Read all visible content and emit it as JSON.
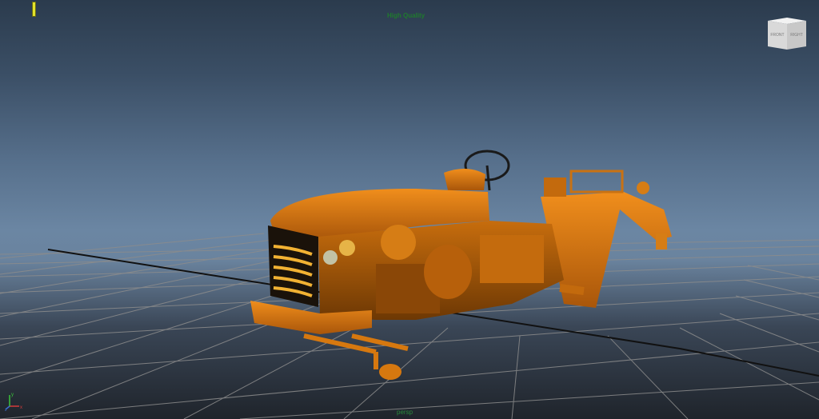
{
  "viewport": {
    "hud": {
      "quality_label": "High Quality",
      "camera_label": "persp"
    },
    "viewcube": {
      "left_face": "FRONT",
      "right_face": "RIGHT"
    },
    "axis_indicator": {
      "x_label": "x",
      "y_label": "y",
      "z_label": "z"
    },
    "colors": {
      "model": "#d6780f",
      "grid": "#8c8c8c",
      "hud_text": "#1f7a2d"
    }
  }
}
